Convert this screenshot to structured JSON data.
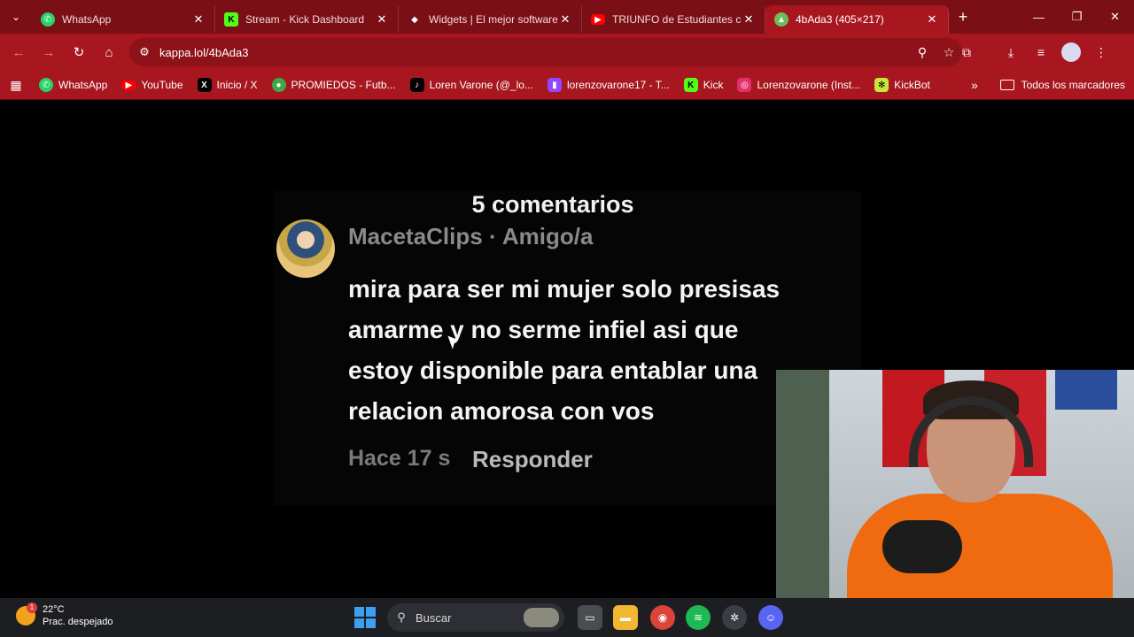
{
  "browser": {
    "tabs": [
      {
        "label": "WhatsApp",
        "icon": "whatsapp-icon",
        "color": "#25d366"
      },
      {
        "label": "Stream - Kick Dashboard",
        "icon": "kick-icon",
        "color": "#53fc18"
      },
      {
        "label": "Widgets | El mejor software",
        "icon": "widgets-icon",
        "color": "#ffffff"
      },
      {
        "label": "TRIUNFO de Estudiantes con",
        "icon": "youtube-icon",
        "color": "#ff0000"
      },
      {
        "label": "4bAda3 (405×217)",
        "icon": "image-icon",
        "color": "#6bbf59"
      }
    ],
    "url": "kappa.lol/4bAda3",
    "bookmarks": [
      {
        "label": "WhatsApp",
        "icon": "whatsapp-icon",
        "color": "#25d366"
      },
      {
        "label": "YouTube",
        "icon": "youtube-icon",
        "color": "#ff0000"
      },
      {
        "label": "Inicio / X",
        "icon": "x-icon",
        "color": "#000000"
      },
      {
        "label": "PROMIEDOS - Futb...",
        "icon": "soccer-ball-icon",
        "color": "#3cab45"
      },
      {
        "label": "Loren Varone (@_lo...",
        "icon": "tiktok-icon",
        "color": "#000000"
      },
      {
        "label": "lorenzovarone17 - T...",
        "icon": "twitch-icon",
        "color": "#9146ff"
      },
      {
        "label": "Kick",
        "icon": "kick-icon",
        "color": "#53fc18"
      },
      {
        "label": "Lorenzovarone (Inst...",
        "icon": "instagram-icon",
        "color": "#e1306c"
      },
      {
        "label": "KickBot",
        "icon": "kickbot-icon",
        "color": "#c7e83a"
      }
    ],
    "all_bookmarks_label": "Todos los marcadores"
  },
  "comment": {
    "count_label": "5 comentarios",
    "author": "MacetaClips · Amigo/a",
    "body": "mira para ser mi mujer solo presisas\namarme y no serme infiel asi que\nestoy disponible para entablar una\nrelacion amorosa con vos",
    "time": "Hace 17 s",
    "reply_label": "Responder"
  },
  "taskbar": {
    "temperature": "22°C",
    "weather": "Prac. despejado",
    "weather_badge": "1",
    "search_label": "Buscar"
  }
}
